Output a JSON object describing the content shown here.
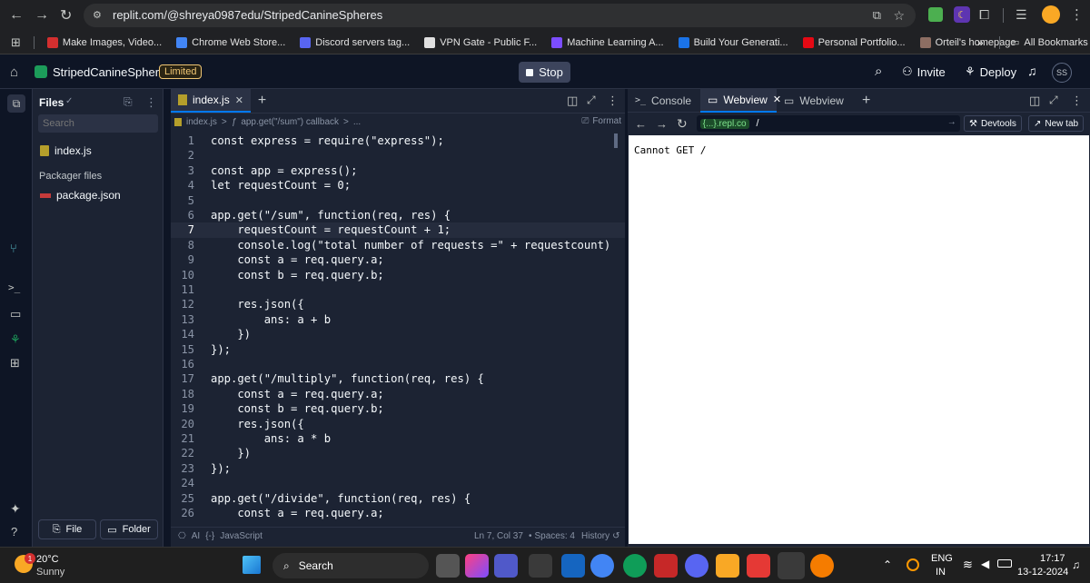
{
  "browser": {
    "url": "replit.com/@shreya0987edu/StripedCanineSpheres",
    "bookmarks": [
      {
        "label": "Make Images, Video...",
        "color": "#d32f2f"
      },
      {
        "label": "Chrome Web Store...",
        "color": "#4285f4"
      },
      {
        "label": "Discord servers tag...",
        "color": "#5865f2"
      },
      {
        "label": "VPN Gate - Public F...",
        "color": "#e0e0e0"
      },
      {
        "label": "Machine Learning A...",
        "color": "#7c4dff"
      },
      {
        "label": "Build Your Generati...",
        "color": "#1a73e8"
      },
      {
        "label": "Personal Portfolio...",
        "color": "#e50914"
      },
      {
        "label": "Orteil's homepage",
        "color": "#8d6e63"
      }
    ],
    "all_bookmarks": "All Bookmarks",
    "more": "»"
  },
  "header": {
    "project": "StripedCanineSpheres",
    "plan_badge": "Limited",
    "stop": "Stop",
    "invite": "Invite",
    "deploy": "Deploy",
    "avatar": "SS"
  },
  "files": {
    "title": "Files",
    "search_placeholder": "Search",
    "items": [
      "index.js"
    ],
    "packager_title": "Packager files",
    "packager_items": [
      "package.json"
    ],
    "file_btn": "File",
    "folder_btn": "Folder"
  },
  "editor": {
    "tab": "index.js",
    "breadcrumb_file": "index.js",
    "breadcrumb_sep": ">",
    "breadcrumb_fn": "app.get(\"/sum\") callback",
    "breadcrumb_more": "...",
    "format": "Format",
    "status_ai": "AI",
    "status_lang": "JavaScript",
    "status_pos": "Ln 7, Col 37",
    "status_spaces": "Spaces: 4",
    "status_history": "History",
    "current_line": 7,
    "lines": [
      "const express = require(\"express\");",
      "",
      "const app = express();",
      "let requestCount = 0;",
      "",
      "app.get(\"/sum\", function(req, res) {",
      "    requestCount = requestCount + 1;",
      "    console.log(\"total number of requests =\" + requestcount)",
      "    const a = req.query.a;",
      "    const b = req.query.b;",
      "",
      "    res.json({",
      "        ans: a + b",
      "    })",
      "});",
      "",
      "app.get(\"/multiply\", function(req, res) {",
      "    const a = req.query.a;",
      "    const b = req.query.b;",
      "    res.json({",
      "        ans: a * b",
      "    })",
      "});",
      "",
      "app.get(\"/divide\", function(req, res) {",
      "    const a = req.query.a;"
    ]
  },
  "webview": {
    "tab_console": "Console",
    "tab_webview": "Webview",
    "tab_webview2": "Webview",
    "domain": "{...}.repl.co",
    "path": "/",
    "devtools": "Devtools",
    "new_tab": "New tab",
    "body_text": "Cannot GET /"
  },
  "taskbar": {
    "temp": "20°C",
    "weather": "Sunny",
    "weather_badge": "1",
    "search": "Search",
    "lang_top": "ENG",
    "lang_bottom": "IN",
    "time": "17:17",
    "date": "13-12-2024"
  }
}
